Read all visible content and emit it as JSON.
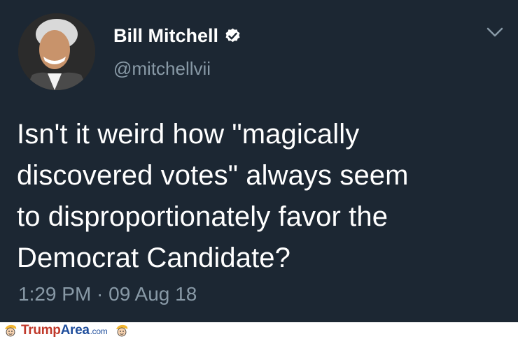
{
  "tweet": {
    "display_name": "Bill Mitchell",
    "handle": "@mitchellvii",
    "text_lines": [
      "Isn't it weird how \"magically",
      "discovered votes\" always seem",
      "to disproportionately favor the",
      "Democrat Candidate?"
    ],
    "timestamp": "1:29 PM · 09 Aug 18",
    "verified": true
  },
  "icons": {
    "avatar": "profile-photo",
    "verified": "verified-badge-icon",
    "menu": "chevron-down-icon",
    "footer_head": "cartoon-head-icon"
  },
  "footer": {
    "brand_part1": "Trump",
    "brand_part2": "Area",
    "brand_part3": ".com"
  },
  "colors": {
    "background": "#1c2733",
    "name": "#ffffff",
    "secondary": "#8899a6",
    "brand_red": "#c0392b",
    "brand_blue": "#1f4e9c"
  }
}
